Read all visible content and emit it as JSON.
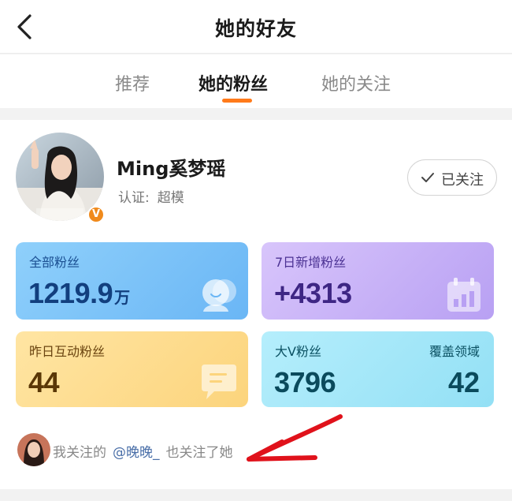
{
  "header": {
    "title": "她的好友"
  },
  "tabs": [
    {
      "label": "推荐"
    },
    {
      "label": "她的粉丝",
      "active": true
    },
    {
      "label": "她的关注"
    }
  ],
  "profile": {
    "name": "Ming奚梦瑶",
    "verify_label": "认证:",
    "verify_value": "超模",
    "badge": "V",
    "follow_label": "已关注"
  },
  "stats": {
    "all_fans": {
      "label": "全部粉丝",
      "value": "1219.9",
      "unit": "万"
    },
    "new_7d": {
      "label": "7日新增粉丝",
      "value": "+4313"
    },
    "interact_yesterday": {
      "label": "昨日互动粉丝",
      "value": "44"
    },
    "bigv": {
      "label": "大V粉丝",
      "value": "3796",
      "label2": "覆盖领域",
      "value2": "42"
    }
  },
  "mutual": {
    "prefix": "我关注的",
    "mention": "@晚晚_",
    "suffix": "也关注了她"
  },
  "colors": {
    "accent": "#ff7a1a",
    "annotation_arrow": "#e0121b",
    "badge": "#f08a1c"
  },
  "icons": [
    "back-icon",
    "check-icon",
    "fans-icon",
    "calendar-chart-icon",
    "chat-icon"
  ]
}
